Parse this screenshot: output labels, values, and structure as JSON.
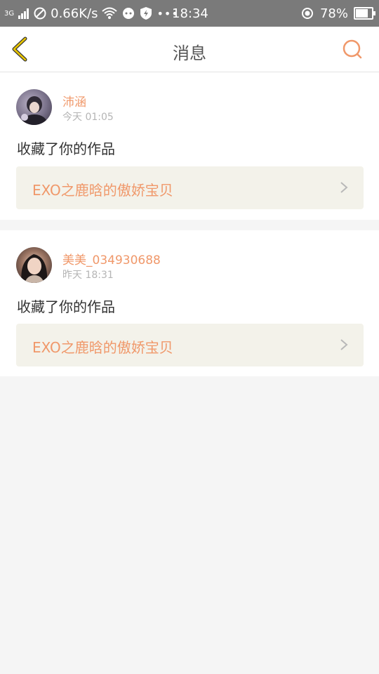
{
  "status_bar": {
    "network": "3G",
    "speed": "0.66K/s",
    "time": "18:34",
    "battery": "78%"
  },
  "header": {
    "title": "消息"
  },
  "messages": [
    {
      "username": "沛涵",
      "time": "今天 01:05",
      "action": "收藏了你的作品",
      "work_title": "EXO之鹿晗的傲娇宝贝"
    },
    {
      "username": "美美_034930688",
      "time": "昨天 18:31",
      "action": "收藏了你的作品",
      "work_title": "EXO之鹿晗的傲娇宝贝"
    }
  ],
  "colors": {
    "accent": "#f0986a",
    "back_icon": "#c9a800",
    "status_bar_bg": "#7a7a7a",
    "card_link_bg": "#f3f2ea"
  }
}
